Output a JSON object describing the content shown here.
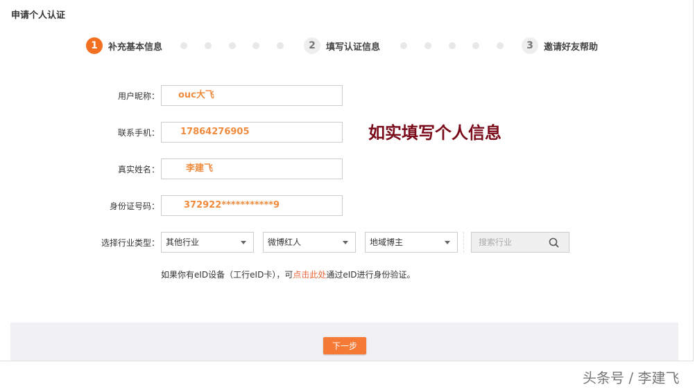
{
  "page_title": "申请个人认证",
  "steps": [
    {
      "num": "1",
      "label": "补充基本信息"
    },
    {
      "num": "2",
      "label": "填写认证信息"
    },
    {
      "num": "3",
      "label": "邀请好友帮助"
    }
  ],
  "form": {
    "nickname": {
      "label": "用户昵称：",
      "value": "ouc大飞"
    },
    "phone": {
      "label": "联系手机：",
      "value": "17864276905"
    },
    "realname": {
      "label": "真实姓名：",
      "value": "李建飞"
    },
    "idnum": {
      "label": "身份证号码：",
      "value": "372922***********9"
    },
    "industry": {
      "label": "选择行业类型：",
      "select1": "其他行业",
      "select2": "微博红人",
      "select3": "地域博主",
      "search_placeholder": "搜索行业"
    }
  },
  "annotation": "如实填写个人信息",
  "eid": {
    "before": "如果你有eID设备（工行eID卡），可",
    "link": "点击此处",
    "after": "通过eID进行身份验证。"
  },
  "next_button": "下一步",
  "watermark": "头条号 / 李建飞",
  "colors": {
    "accent": "#f36f21",
    "annotation": "#7a0a1a"
  }
}
